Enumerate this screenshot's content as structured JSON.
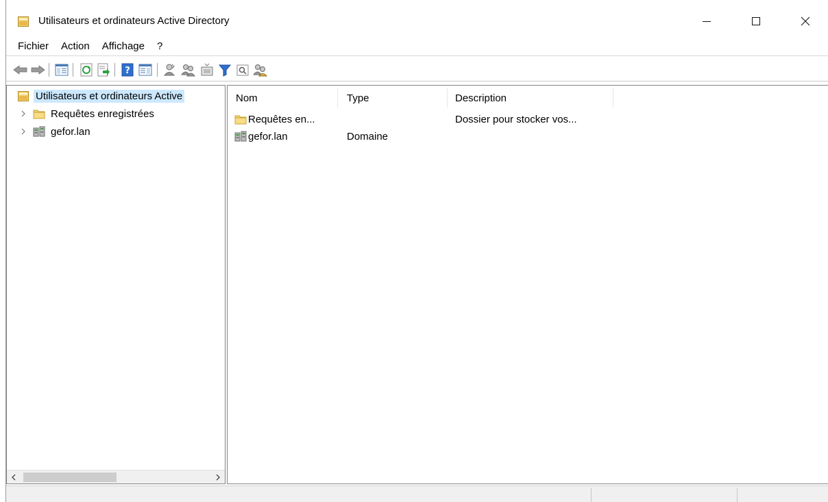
{
  "window": {
    "title": "Utilisateurs et ordinateurs Active Directory"
  },
  "menu": [
    "Fichier",
    "Action",
    "Affichage",
    "?"
  ],
  "toolbar": {
    "icons": [
      "back-arrow-icon",
      "forward-arrow-icon",
      "show-hide-console-tree-icon",
      "refresh-icon",
      "export-list-icon",
      "help-icon",
      "show-hide-action-pane-icon",
      "create-user-icon",
      "create-group-icon",
      "create-ou-icon",
      "filter-icon",
      "find-icon",
      "add-to-group-icon"
    ]
  },
  "tree": {
    "root_label": "Utilisateurs et ordinateurs Active",
    "items": [
      {
        "label": "Requêtes enregistrées",
        "icon": "folder-icon"
      },
      {
        "label": "gefor.lan",
        "icon": "domain-icon"
      }
    ]
  },
  "list": {
    "columns": [
      "Nom",
      "Type",
      "Description"
    ],
    "rows": [
      {
        "name": "Requêtes en...",
        "type": "",
        "description": "Dossier pour stocker vos...",
        "icon": "folder-icon"
      },
      {
        "name": "gefor.lan",
        "type": "Domaine",
        "description": "",
        "icon": "domain-icon"
      }
    ]
  },
  "colors": {
    "selection": "#cce8ff",
    "folder": "#f3d47a",
    "help_blue": "#2f6fce"
  }
}
